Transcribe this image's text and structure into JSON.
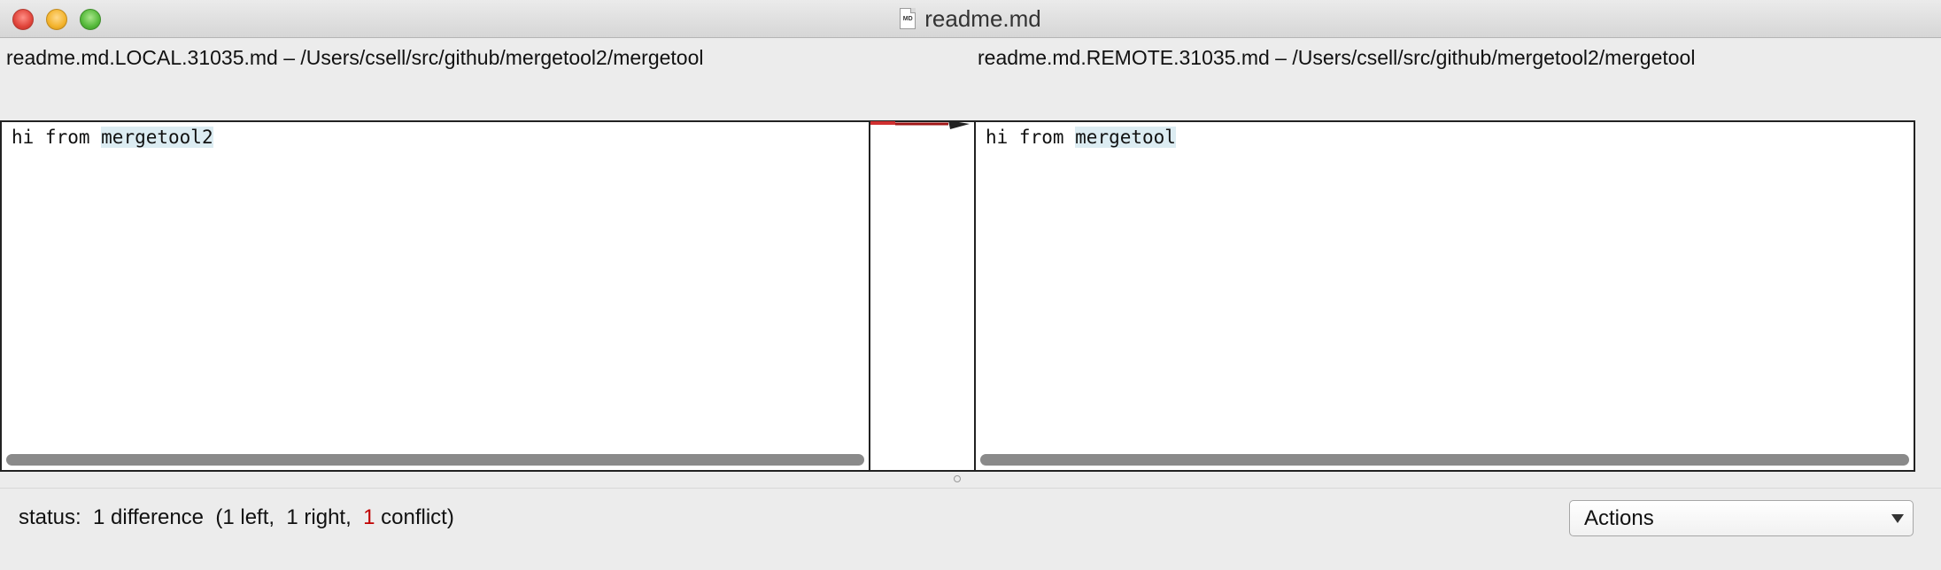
{
  "window": {
    "title": "readme.md",
    "file_icon_label": "MD"
  },
  "left": {
    "header": "readme.md.LOCAL.31035.md – /Users/csell/src/github/mergetool2/mergetool",
    "line_prefix": "hi from ",
    "line_highlight": "mergetool2"
  },
  "right": {
    "header": "readme.md.REMOTE.31035.md – /Users/csell/src/github/mergetool2/mergetool",
    "line_prefix": "hi from ",
    "line_highlight": "mergetool"
  },
  "status": {
    "prefix": "status:  1 difference  (1 left,  1 right,  ",
    "conflict_count": "1",
    "suffix": " conflict)"
  },
  "actions": {
    "label": "Actions"
  },
  "colors": {
    "conflict": "#c00000",
    "highlight": "#dcecf2"
  }
}
